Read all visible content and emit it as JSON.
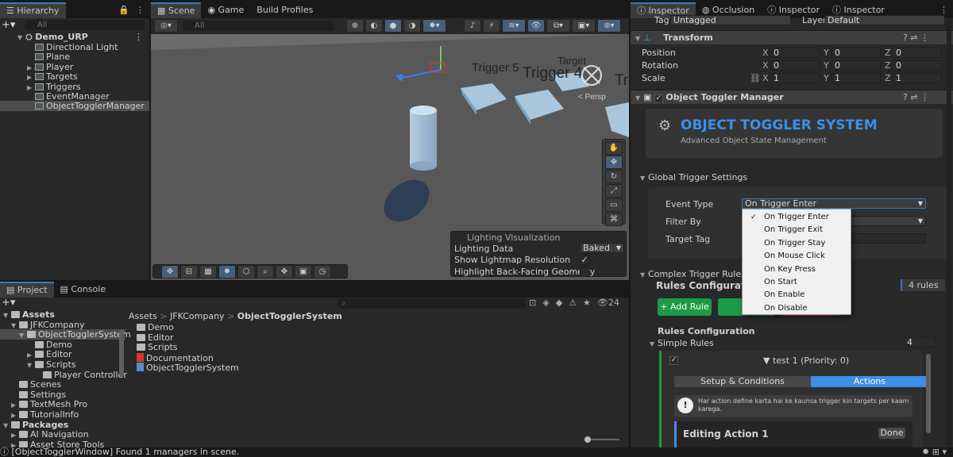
{
  "hierarchy": {
    "tab": "Hierarchy",
    "search": "All",
    "scene": "Demo_URP",
    "items": [
      {
        "label": "Directional Light",
        "arrow": ""
      },
      {
        "label": "Plane",
        "arrow": ""
      },
      {
        "label": "Player",
        "arrow": "▶"
      },
      {
        "label": "Targets",
        "arrow": "▶"
      },
      {
        "label": "Triggers",
        "arrow": "▶"
      },
      {
        "label": "EventManager",
        "arrow": ""
      },
      {
        "label": "ObjectTogglerManager",
        "arrow": ""
      }
    ]
  },
  "scene": {
    "tabs": [
      "Scene",
      "Game",
      "Build Profiles"
    ],
    "search": "All",
    "persp": "< Persp",
    "labels": [
      "Trigger 5",
      "Trigger 4",
      "Target",
      "Tr"
    ],
    "lighting": {
      "title": "Lighting Visualization",
      "data_label": "Lighting Data",
      "data_value": "Baked",
      "lightmap": "Show Lightmap Resolution",
      "backface": "Highlight Back-Facing Geometry"
    }
  },
  "project": {
    "tabs": [
      "Project",
      "Console"
    ],
    "count": "24",
    "breadcrumb": [
      "Assets",
      "JFKCompany",
      "ObjectTogglerSystem"
    ],
    "tree": [
      {
        "label": "Assets",
        "bold": true,
        "arrow": "▼",
        "indent": 0
      },
      {
        "label": "JFKCompany",
        "arrow": "▼",
        "indent": 1
      },
      {
        "label": "ObjectTogglerSystem",
        "arrow": "▼",
        "indent": 2,
        "sel": true
      },
      {
        "label": "Demo",
        "arrow": "",
        "indent": 3
      },
      {
        "label": "Editor",
        "arrow": "▶",
        "indent": 3
      },
      {
        "label": "Scripts",
        "arrow": "▼",
        "indent": 3
      },
      {
        "label": "Player Controller",
        "arrow": "",
        "indent": 4
      },
      {
        "label": "Scenes",
        "arrow": "",
        "indent": 1
      },
      {
        "label": "Settings",
        "arrow": "",
        "indent": 1
      },
      {
        "label": "TextMesh Pro",
        "arrow": "▶",
        "indent": 1
      },
      {
        "label": "TutorialInfo",
        "arrow": "▶",
        "indent": 1
      },
      {
        "label": "Packages",
        "bold": true,
        "arrow": "▼",
        "indent": 0
      },
      {
        "label": "AI Navigation",
        "arrow": "▶",
        "indent": 1
      },
      {
        "label": "Asset Store Tools",
        "arrow": "▶",
        "indent": 1
      }
    ],
    "files": [
      "Demo",
      "Editor",
      "Scripts",
      "Documentation",
      "ObjectTogglerSystem"
    ]
  },
  "status": "[ObjectTogglerWindow] Found 1 managers in scene.",
  "inspector": {
    "tabs": [
      "Inspector",
      "Occlusion",
      "Inspector",
      "Inspector"
    ],
    "tag_label": "Tag",
    "tag_value": "Untagged",
    "layer_label": "Layer",
    "layer_value": "Default",
    "transform": {
      "title": "Transform",
      "rows": [
        {
          "label": "Position",
          "x": "0",
          "y": "0",
          "z": "0"
        },
        {
          "label": "Rotation",
          "x": "0",
          "y": "0",
          "z": "0"
        },
        {
          "label": "Scale",
          "x": "1",
          "y": "1",
          "z": "1"
        }
      ]
    },
    "component": "Object Toggler Manager",
    "banner_title": "OBJECT TOGGLER SYSTEM",
    "banner_sub": "Advanced Object State Management",
    "global": "Global Trigger Settings",
    "event_type": "Event Type",
    "event_value": "On Trigger Enter",
    "filter_by": "Filter By",
    "target_tag": "Target Tag",
    "dropdown": [
      "On Trigger Enter",
      "On Trigger Exit",
      "On Trigger Stay",
      "On Mouse Click",
      "On Key Press",
      "On Start",
      "On Enable",
      "On Disable"
    ],
    "complex": "Complex Trigger Rules",
    "rules_config": "Rules Configuration",
    "rules_count": "4 rules",
    "add_rule": "+ Add Rule",
    "edit_partial": "E",
    "rules_config2": "Rules Configuration",
    "simple_rules": "Simple Rules",
    "simple_count": "4",
    "rule_title": "▼ test 1 (Priority: 0)",
    "setup_tab": "Setup & Conditions",
    "actions_tab": "Actions",
    "info": "Har action define karta hai ke kaunsa trigger kin targets per kaam karega.",
    "editing": "Editing Action 1",
    "done": "Done"
  }
}
